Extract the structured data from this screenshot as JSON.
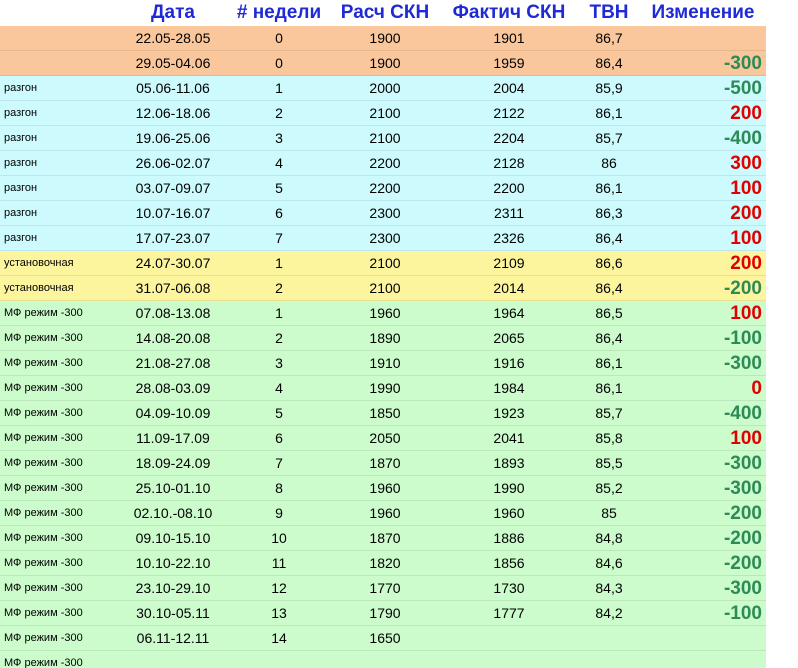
{
  "header": [
    "",
    "Дата",
    "# недели",
    "Расч СКН",
    "Фактич СКН",
    "ТВН",
    "Изменение"
  ],
  "rows": [
    {
      "label": "",
      "date": "22.05-28.05",
      "week": "0",
      "calc": "1900",
      "fact": "1901",
      "tvn": "86,7",
      "change": "",
      "change_color": "",
      "bg": "orange"
    },
    {
      "label": "",
      "date": "29.05-04.06",
      "week": "0",
      "calc": "1900",
      "fact": "1959",
      "tvn": "86,4",
      "change": "-300",
      "change_color": "green",
      "bg": "orange"
    },
    {
      "label": "разгон",
      "date": "05.06-11.06",
      "week": "1",
      "calc": "2000",
      "fact": "2004",
      "tvn": "85,9",
      "change": "-500",
      "change_color": "green",
      "bg": "cyan"
    },
    {
      "label": "разгон",
      "date": "12.06-18.06",
      "week": "2",
      "calc": "2100",
      "fact": "2122",
      "tvn": "86,1",
      "change": "200",
      "change_color": "red",
      "bg": "cyan"
    },
    {
      "label": "разгон",
      "date": "19.06-25.06",
      "week": "3",
      "calc": "2100",
      "fact": "2204",
      "tvn": "85,7",
      "change": "-400",
      "change_color": "green",
      "bg": "cyan"
    },
    {
      "label": "разгон",
      "date": "26.06-02.07",
      "week": "4",
      "calc": "2200",
      "fact": "2128",
      "tvn": "86",
      "change": "300",
      "change_color": "red",
      "bg": "cyan"
    },
    {
      "label": "разгон",
      "date": "03.07-09.07",
      "week": "5",
      "calc": "2200",
      "fact": "2200",
      "tvn": "86,1",
      "change": "100",
      "change_color": "red",
      "bg": "cyan"
    },
    {
      "label": "разгон",
      "date": "10.07-16.07",
      "week": "6",
      "calc": "2300",
      "fact": "2311",
      "tvn": "86,3",
      "change": "200",
      "change_color": "red",
      "bg": "cyan"
    },
    {
      "label": "разгон",
      "date": "17.07-23.07",
      "week": "7",
      "calc": "2300",
      "fact": "2326",
      "tvn": "86,4",
      "change": "100",
      "change_color": "red",
      "bg": "cyan"
    },
    {
      "label": "установочная",
      "date": "24.07-30.07",
      "week": "1",
      "calc": "2100",
      "fact": "2109",
      "tvn": "86,6",
      "change": "200",
      "change_color": "red",
      "bg": "yellow"
    },
    {
      "label": "установочная",
      "date": "31.07-06.08",
      "week": "2",
      "calc": "2100",
      "fact": "2014",
      "tvn": "86,4",
      "change": "-200",
      "change_color": "green",
      "bg": "yellow"
    },
    {
      "label": "МФ режим -300",
      "date": "07.08-13.08",
      "week": "1",
      "calc": "1960",
      "fact": "1964",
      "tvn": "86,5",
      "change": "100",
      "change_color": "red",
      "bg": "green"
    },
    {
      "label": "МФ режим -300",
      "date": "14.08-20.08",
      "week": "2",
      "calc": "1890",
      "fact": "2065",
      "tvn": "86,4",
      "change": "-100",
      "change_color": "green",
      "bg": "green"
    },
    {
      "label": "МФ режим -300",
      "date": "21.08-27.08",
      "week": "3",
      "calc": "1910",
      "fact": "1916",
      "tvn": "86,1",
      "change": "-300",
      "change_color": "green",
      "bg": "green"
    },
    {
      "label": "МФ режим -300",
      "date": "28.08-03.09",
      "week": "4",
      "calc": "1990",
      "fact": "1984",
      "tvn": "86,1",
      "change": "0",
      "change_color": "red",
      "bg": "green"
    },
    {
      "label": "МФ режим -300",
      "date": "04.09-10.09",
      "week": "5",
      "calc": "1850",
      "fact": "1923",
      "tvn": "85,7",
      "change": "-400",
      "change_color": "green",
      "bg": "green"
    },
    {
      "label": "МФ режим -300",
      "date": "11.09-17.09",
      "week": "6",
      "calc": "2050",
      "fact": "2041",
      "tvn": "85,8",
      "change": "100",
      "change_color": "red",
      "bg": "green"
    },
    {
      "label": "МФ режим -300",
      "date": "18.09-24.09",
      "week": "7",
      "calc": "1870",
      "fact": "1893",
      "tvn": "85,5",
      "change": "-300",
      "change_color": "green",
      "bg": "green"
    },
    {
      "label": "МФ режим -300",
      "date": "25.10-01.10",
      "week": "8",
      "calc": "1960",
      "fact": "1990",
      "tvn": "85,2",
      "change": "-300",
      "change_color": "green",
      "bg": "green"
    },
    {
      "label": "МФ режим -300",
      "date": "02.10.-08.10",
      "week": "9",
      "calc": "1960",
      "fact": "1960",
      "tvn": "85",
      "change": "-200",
      "change_color": "green",
      "bg": "green"
    },
    {
      "label": "МФ режим -300",
      "date": "09.10-15.10",
      "week": "10",
      "calc": "1870",
      "fact": "1886",
      "tvn": "84,8",
      "change": "-200",
      "change_color": "green",
      "bg": "green"
    },
    {
      "label": "МФ режим -300",
      "date": "10.10-22.10",
      "week": "11",
      "calc": "1820",
      "fact": "1856",
      "tvn": "84,6",
      "change": "-200",
      "change_color": "green",
      "bg": "green"
    },
    {
      "label": "МФ режим -300",
      "date": "23.10-29.10",
      "week": "12",
      "calc": "1770",
      "fact": "1730",
      "tvn": "84,3",
      "change": "-300",
      "change_color": "green",
      "bg": "green"
    },
    {
      "label": "МФ режим -300",
      "date": "30.10-05.11",
      "week": "13",
      "calc": "1790",
      "fact": "1777",
      "tvn": "84,2",
      "change": "-100",
      "change_color": "green",
      "bg": "green"
    },
    {
      "label": "МФ режим -300",
      "date": "06.11-12.11",
      "week": "14",
      "calc": "1650",
      "fact": "",
      "tvn": "",
      "change": "",
      "change_color": "",
      "bg": "green"
    },
    {
      "label": "МФ режим -300",
      "date": "",
      "week": "",
      "calc": "",
      "fact": "",
      "tvn": "",
      "change": "",
      "change_color": "",
      "bg": "green"
    }
  ],
  "colors": {
    "header_text": "#1f2ad6",
    "positive": "#e00000",
    "negative": "#2e8b57",
    "orange": "#f9c79b",
    "cyan": "#ccfafd",
    "yellow": "#fdf59e",
    "green": "#ccfbcc"
  }
}
